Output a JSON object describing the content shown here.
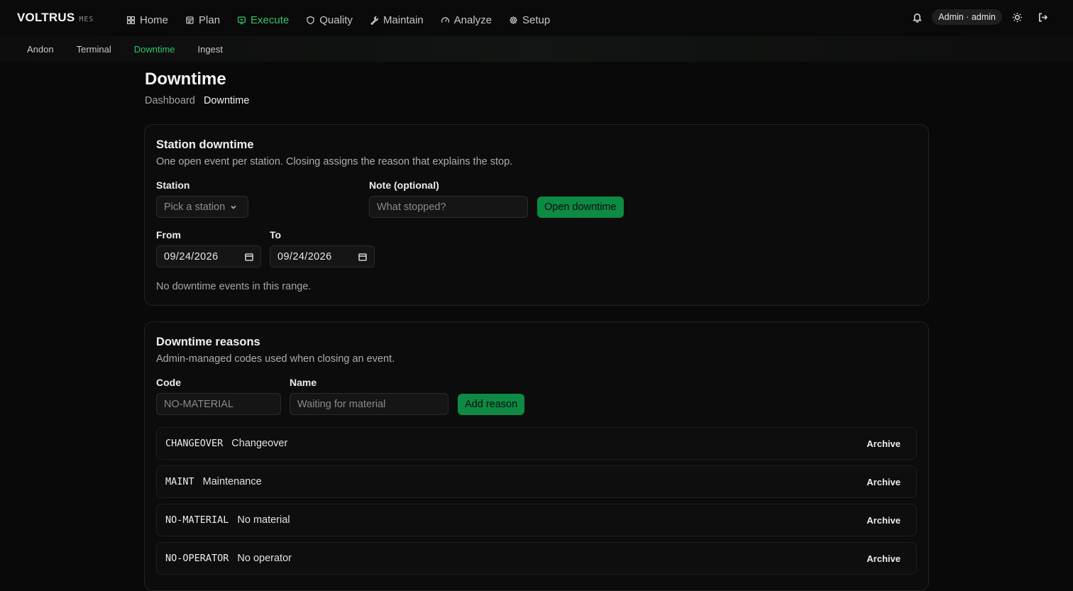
{
  "brand": {
    "name": "VOLTRUS",
    "tag": "MES"
  },
  "nav": {
    "items": [
      {
        "label": "Home",
        "icon": "grid-icon"
      },
      {
        "label": "Plan",
        "icon": "calendar-icon"
      },
      {
        "label": "Execute",
        "icon": "monitor-icon",
        "active": true
      },
      {
        "label": "Quality",
        "icon": "shield-icon"
      },
      {
        "label": "Maintain",
        "icon": "wrench-icon"
      },
      {
        "label": "Analyze",
        "icon": "gauge-icon"
      },
      {
        "label": "Setup",
        "icon": "gear-icon"
      }
    ]
  },
  "user": {
    "badge": "Admin · admin"
  },
  "subnav": {
    "items": [
      {
        "label": "Andon"
      },
      {
        "label": "Terminal"
      },
      {
        "label": "Downtime",
        "active": true
      },
      {
        "label": "Ingest"
      }
    ]
  },
  "page": {
    "title": "Downtime"
  },
  "breadcrumb": {
    "parent": "Dashboard",
    "current": "Downtime"
  },
  "station_card": {
    "title": "Station downtime",
    "description": "One open event per station. Closing assigns the reason that explains the stop.",
    "station_label": "Station",
    "station_placeholder": "Pick a station",
    "note_label": "Note (optional)",
    "note_placeholder": "What stopped?",
    "open_button": "Open downtime",
    "from_label": "From",
    "from_value": "09/24/2026",
    "to_label": "To",
    "to_value": "09/24/2026",
    "empty_text": "No downtime events in this range."
  },
  "reasons_card": {
    "title": "Downtime reasons",
    "description": "Admin-managed codes used when closing an event.",
    "code_label": "Code",
    "code_placeholder": "NO-MATERIAL",
    "name_label": "Name",
    "name_placeholder": "Waiting for material",
    "add_button": "Add reason",
    "archive_label": "Archive",
    "reasons": [
      {
        "code": "CHANGEOVER",
        "name": "Changeover"
      },
      {
        "code": "MAINT",
        "name": "Maintenance"
      },
      {
        "code": "NO-MATERIAL",
        "name": "No material"
      },
      {
        "code": "NO-OPERATOR",
        "name": "No operator"
      }
    ]
  },
  "colors": {
    "accent": "#2fc46b",
    "button": "#0d8a43",
    "background": "#090909"
  }
}
